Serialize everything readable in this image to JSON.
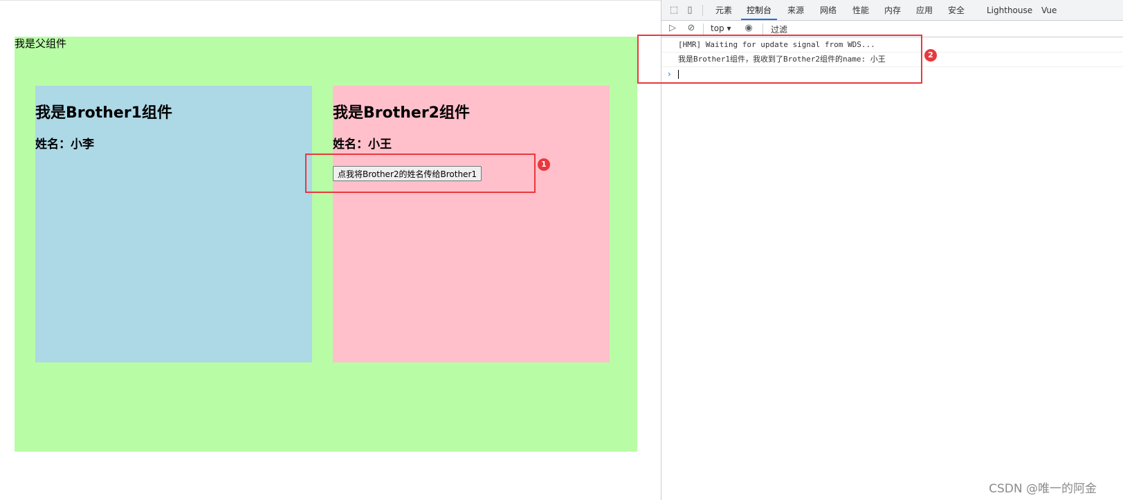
{
  "app": {
    "parent_label": "我是父组件",
    "brother1": {
      "title": "我是Brother1组件",
      "name_line": "姓名：小李"
    },
    "brother2": {
      "title": "我是Brother2组件",
      "name_line": "姓名：小王",
      "button_label": "点我将Brother2的姓名传给Brother1"
    }
  },
  "annotations": {
    "marker1": "1",
    "marker2": "2"
  },
  "devtools": {
    "tabs": [
      "元素",
      "控制台",
      "来源",
      "网络",
      "性能",
      "内存",
      "应用",
      "安全",
      "Lighthouse",
      "Vue"
    ],
    "active_tab": "控制台",
    "context": "top",
    "filter_placeholder": "过滤",
    "console_lines": [
      "[HMR] Waiting for update signal from WDS...",
      "我是Brother1组件，我收到了Brother2组件的name:  小王"
    ]
  },
  "watermark": "CSDN @唯一的阿金",
  "colors": {
    "parent_bg": "#b9fca6",
    "brother1_bg": "#add8e6",
    "brother2_bg": "#ffc0cb",
    "annotation_red": "#e8383d",
    "active_tab_underline": "#1a73e8"
  }
}
